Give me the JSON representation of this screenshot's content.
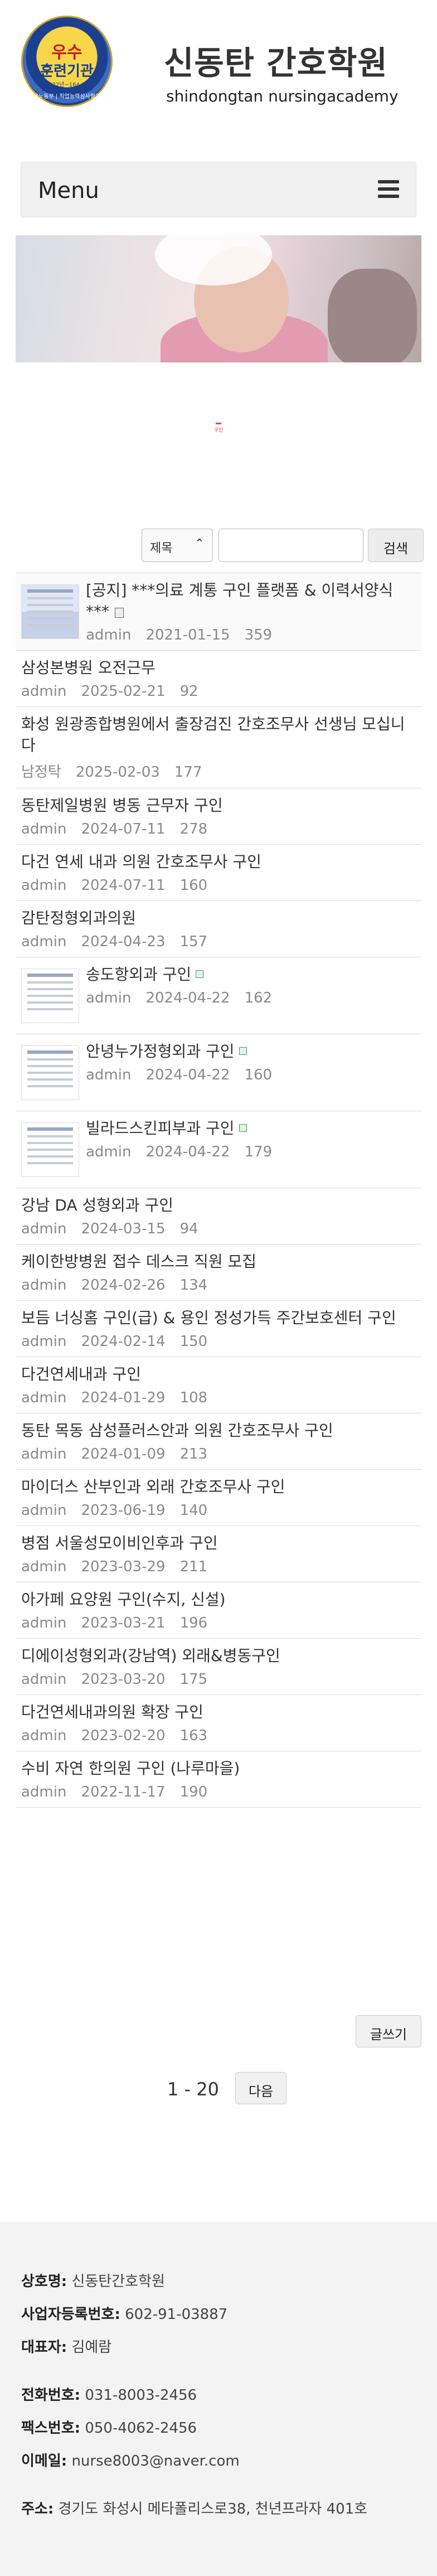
{
  "brand": {
    "logo_text_top": "우수",
    "logo_text_mid": "훈련기관",
    "logo_text_line1": "2022년~164-01",
    "logo_text_line2": "2022.01~2027.12",
    "logo_ring_text": "고용노동부 | 직업능력심사평가원",
    "name_ko": "신동탄 간호학원",
    "name_en": "shindongtan nursingacademy"
  },
  "menu": {
    "label": "Menu",
    "icon": "hamburger-icon"
  },
  "pin": {
    "label": "구인"
  },
  "search": {
    "field_label": "제목",
    "field_icon": "chevron-down-icon",
    "query": "",
    "button_label": "검색"
  },
  "posts": [
    {
      "title": "[공지] ***의료 계통 구인 플랫폼 & 이력서양식***",
      "author": "admin",
      "date": "2021-01-15",
      "views": "359",
      "notice": true
    },
    {
      "title": "삼성본병원 오전근무",
      "author": "admin",
      "date": "2025-02-21",
      "views": "92"
    },
    {
      "title": "화성 원광종합병원에서 출장검진 간호조무사 선생님 모십니다",
      "author": "남정탁",
      "date": "2025-02-03",
      "views": "177"
    },
    {
      "title": "동탄제일병원 병동 근무자 구인",
      "author": "admin",
      "date": "2024-07-11",
      "views": "278"
    },
    {
      "title": "다건 연세 내과 의원 간호조무사 구인",
      "author": "admin",
      "date": "2024-07-11",
      "views": "160"
    },
    {
      "title": "감탄정형외과의원",
      "author": "admin",
      "date": "2024-04-23",
      "views": "157"
    },
    {
      "title": "송도항외과 구인",
      "author": "admin",
      "date": "2024-04-22",
      "views": "162",
      "thumb": true
    },
    {
      "title": "안녕누가정형외과 구인",
      "author": "admin",
      "date": "2024-04-22",
      "views": "160",
      "thumb": true
    },
    {
      "title": "빌라드스킨피부과 구인",
      "author": "admin",
      "date": "2024-04-22",
      "views": "179",
      "thumb": true
    },
    {
      "title": "강남 DA 성형외과 구인",
      "author": "admin",
      "date": "2024-03-15",
      "views": "94"
    },
    {
      "title": "케이한방병원 접수 데스크 직원 모집",
      "author": "admin",
      "date": "2024-02-26",
      "views": "134"
    },
    {
      "title": "보듬 너싱홈 구인(급) & 용인 정성가득 주간보호센터 구인",
      "author": "admin",
      "date": "2024-02-14",
      "views": "150"
    },
    {
      "title": "다건연세내과 구인",
      "author": "admin",
      "date": "2024-01-29",
      "views": "108"
    },
    {
      "title": "동탄 목동 삼성플러스안과 의원 간호조무사 구인",
      "author": "admin",
      "date": "2024-01-09",
      "views": "213"
    },
    {
      "title": "마이더스 산부인과 외래 간호조무사 구인",
      "author": "admin",
      "date": "2023-06-19",
      "views": "140"
    },
    {
      "title": "병점 서울성모이비인후과 구인",
      "author": "admin",
      "date": "2023-03-29",
      "views": "211"
    },
    {
      "title": "아가페 요양원 구인(수지, 신설)",
      "author": "admin",
      "date": "2023-03-21",
      "views": "196"
    },
    {
      "title": "디에이성형외과(강남역) 외래&병동구인",
      "author": "admin",
      "date": "2023-03-20",
      "views": "175"
    },
    {
      "title": "다건연세내과의원 확장 구인",
      "author": "admin",
      "date": "2023-02-20",
      "views": "163"
    },
    {
      "title": "수비 자연 한의원 구인 (나루마을)",
      "author": "admin",
      "date": "2022-11-17",
      "views": "190"
    }
  ],
  "actions": {
    "write_label": "글쓰기"
  },
  "pagination": {
    "range": "1 - 20",
    "next_label": "다음"
  },
  "footer": {
    "company_label": "상호명:",
    "company": "신동탄간호학원",
    "bizno_label": "사업자등록번호:",
    "bizno": "602-91-03887",
    "ceo_label": "대표자:",
    "ceo": "김예람",
    "tel_label": "전화번호:",
    "tel": "031-8003-2456",
    "fax_label": "팩스번호:",
    "fax": "050-4062-2456",
    "email_label": "이메일:",
    "email": "nurse8003@naver.com",
    "addr_label": "주소:",
    "addr": "경기도 화성시 메타폴리스로38, 천년프라자 401호"
  }
}
